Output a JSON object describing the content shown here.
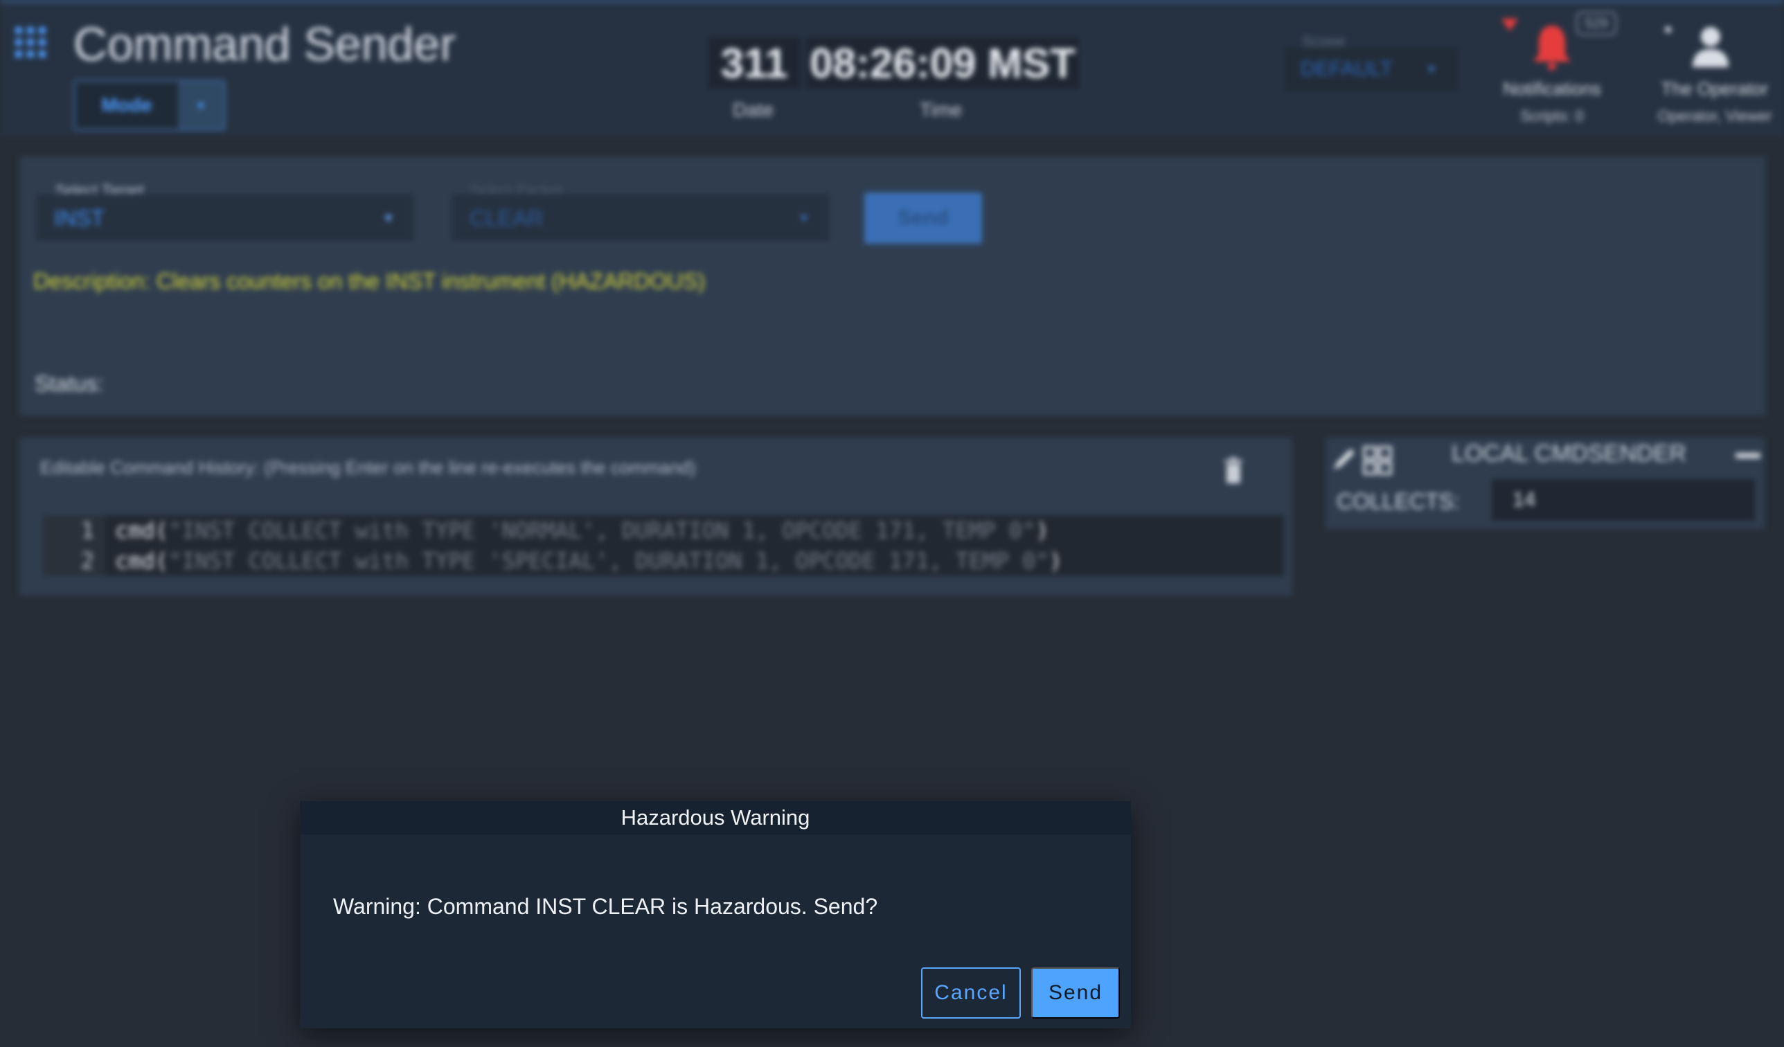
{
  "app": {
    "title": "Command Sender",
    "mode_label": "Mode"
  },
  "clock": {
    "date_value": "311",
    "time_value": "08:26:09 MST",
    "date_label": "Date",
    "time_label": "Time"
  },
  "scope": {
    "label": "Scope",
    "value": "DEFAULT"
  },
  "notifications": {
    "badge_count": "529",
    "label": "Notifications",
    "sub": "Scripts: 0"
  },
  "user": {
    "name": "The Operator",
    "roles": "Operator, Viewer"
  },
  "command": {
    "target_label": "Select Target",
    "target_value": "INST",
    "packet_label": "Select Packet",
    "packet_value": "CLEAR",
    "send_label": "Send",
    "description": "Description: Clears counters on the INST instrument (HAZARDOUS)",
    "status_label": "Status:"
  },
  "history": {
    "title": "Editable Command History: (Pressing Enter on the line re-executes the command)",
    "lines": [
      {
        "num": "1",
        "prefix": "cmd(",
        "text": "\"INST COLLECT with TYPE 'NORMAL', DURATION 1, OPCODE 171, TEMP 0\"",
        "suffix": ")"
      },
      {
        "num": "2",
        "prefix": "cmd(",
        "text": "\"INST COLLECT with TYPE 'SPECIAL', DURATION 1, OPCODE 171, TEMP 0\"",
        "suffix": ")"
      }
    ]
  },
  "local": {
    "title": "LOCAL CMDSENDER",
    "collects_label": "COLLECTS:",
    "collects_value": "14"
  },
  "dialog": {
    "title": "Hazardous Warning",
    "message": "Warning: Command INST CLEAR is Hazardous. Send?",
    "cancel_label": "Cancel",
    "send_label": "Send"
  },
  "colors": {
    "accent": "#4ea3fc",
    "warning_text": "#d8d63a",
    "alert": "#e53d3d"
  },
  "icons": [
    "apps-grid-icon",
    "chevron-down-icon",
    "bell-icon",
    "arrow-down-icon",
    "user-icon",
    "pencil-icon",
    "grid-icon",
    "trash-icon",
    "minus-icon"
  ]
}
